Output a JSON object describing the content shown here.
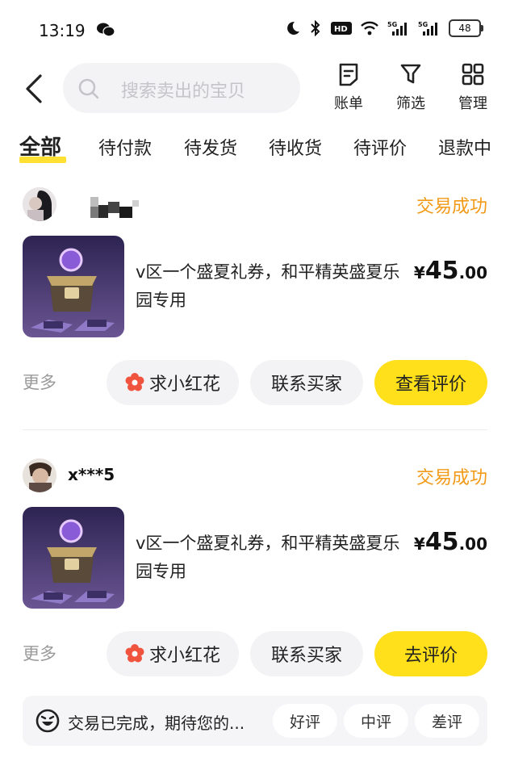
{
  "status_bar": {
    "time": "13:19",
    "battery": "48"
  },
  "header": {
    "search_placeholder": "搜索卖出的宝贝",
    "tools": [
      {
        "icon": "bill-icon",
        "label": "账单"
      },
      {
        "icon": "filter-icon",
        "label": "筛选"
      },
      {
        "icon": "grid-icon",
        "label": "管理"
      }
    ]
  },
  "tabs": [
    "全部",
    "待付款",
    "待发货",
    "待收货",
    "待评价",
    "退款中"
  ],
  "orders": [
    {
      "buyer": "",
      "status": "交易成功",
      "title": "v区一个盛夏礼券，和平精英盛夏乐园专用",
      "price": {
        "currency": "¥",
        "integer": "45",
        "decimal": ".00"
      },
      "more": "更多",
      "buttons": {
        "flower": "求小红花",
        "contact": "联系买家",
        "primary": "查看评价"
      }
    },
    {
      "buyer": "x***5",
      "status": "交易成功",
      "title": "v区一个盛夏礼券，和平精英盛夏乐园专用",
      "price": {
        "currency": "¥",
        "integer": "45",
        "decimal": ".00"
      },
      "more": "更多",
      "buttons": {
        "flower": "求小红花",
        "contact": "联系买家",
        "primary": "去评价"
      }
    }
  ],
  "review_bar": {
    "text": "交易已完成，期待您的...",
    "options": [
      "好评",
      "中评",
      "差评"
    ]
  },
  "colors": {
    "accent_yellow": "#ffe01a",
    "status_orange": "#f29a17"
  }
}
